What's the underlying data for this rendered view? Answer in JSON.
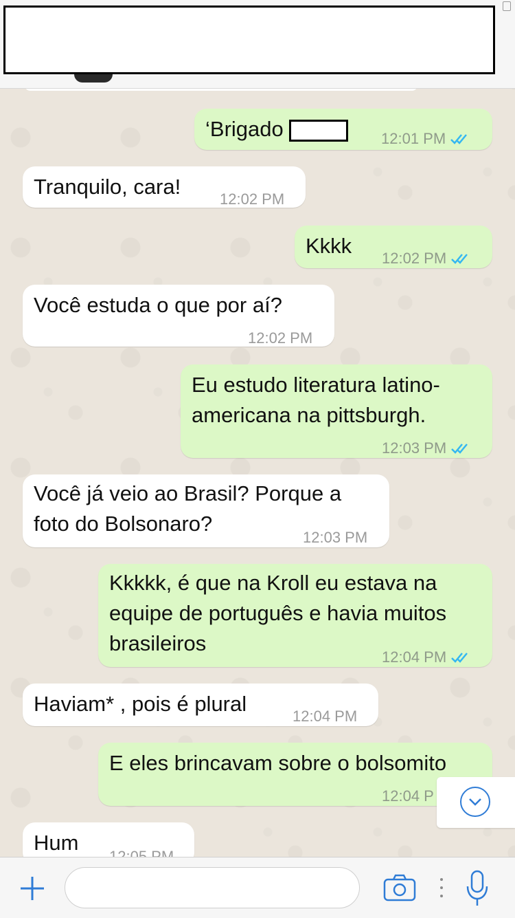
{
  "header": {
    "redacted": true
  },
  "messages": [
    {
      "dir": "out",
      "text": "‘Brigado",
      "time": "12:01 PM",
      "read": true
    },
    {
      "dir": "in",
      "text": "Tranquilo, cara!",
      "time": "12:02 PM"
    },
    {
      "dir": "out",
      "text": "Kkkk",
      "time": "12:02 PM",
      "read": true
    },
    {
      "dir": "in",
      "text": "Você estuda o que por aí?",
      "time": "12:02 PM"
    },
    {
      "dir": "out",
      "line1": "Eu estudo literatura latino-",
      "line2": "americana na pittsburgh.",
      "time": "12:03 PM",
      "read": true
    },
    {
      "dir": "in",
      "line1": "Você já veio ao Brasil? Porque a",
      "line2": "foto do Bolsonaro?",
      "time": "12:03 PM"
    },
    {
      "dir": "out",
      "line1": "Kkkkk, é que na Kroll eu estava na",
      "line2": "equipe de português e havia muitos",
      "line3": "brasileiros",
      "time": "12:04 PM",
      "read": true
    },
    {
      "dir": "in",
      "text": "Haviam* , pois é plural",
      "time": "12:04 PM"
    },
    {
      "dir": "out",
      "text": "E eles brincavam sobre o bolsomito",
      "time": "12:04 P"
    },
    {
      "dir": "in",
      "text": "Hum",
      "time": "12:05 PM"
    }
  ],
  "colors": {
    "outgoing": "#dcf8c6",
    "incoming": "#ffffff",
    "tick": "#34b7f1",
    "accent": "#2f7cd6"
  },
  "icons": {
    "attach": "plus-icon",
    "camera": "camera-icon",
    "more": "more-dots-icon",
    "mic": "microphone-icon",
    "scroll": "chevron-down-icon"
  }
}
